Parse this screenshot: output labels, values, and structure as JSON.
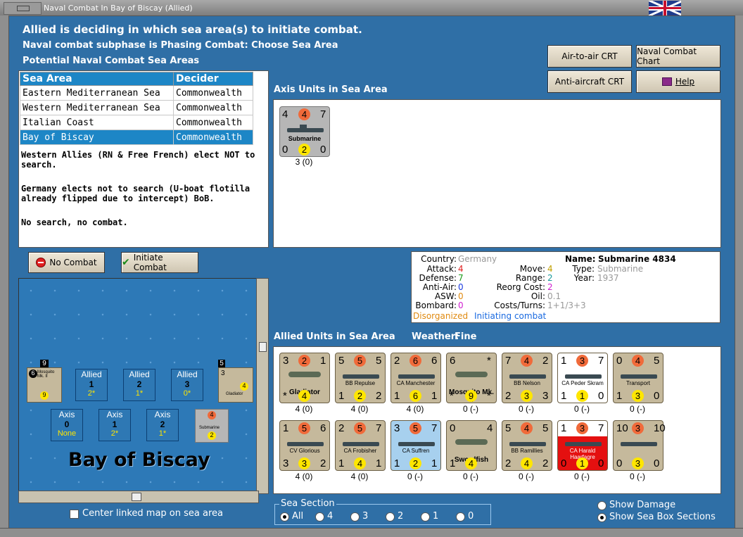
{
  "window": {
    "title": "Naval Combat In Bay of Biscay (Allied)"
  },
  "header": {
    "line1": "Allied is deciding in which sea area(s) to initiate combat.",
    "line2": "Naval combat subphase is Phasing Combat: Choose Sea Area",
    "line3": "Potential Naval Combat Sea Areas"
  },
  "buttons": {
    "air_to_air": "Air-to-air CRT",
    "naval_chart": "Naval Combat Chart",
    "anti_aircraft": "Anti-aircraft CRT",
    "help": "Help",
    "no_combat": "No Combat",
    "initiate_combat": "Initiate Combat"
  },
  "sea_table": {
    "headers": [
      "Sea Area",
      "Decider"
    ],
    "rows": [
      [
        "Eastern Mediterranean Sea",
        "Commonwealth"
      ],
      [
        "Western Mediterranean Sea",
        "Commonwealth"
      ],
      [
        "Italian Coast",
        "Commonwealth"
      ],
      [
        "Bay of Biscay",
        "Commonwealth"
      ]
    ],
    "selected_index": 3
  },
  "notes": [
    "Western Allies (RN & Free French) elect NOT to search.",
    "Germany elects not to search (U-boat flotilla already flipped due to intercept) BoB.",
    "No search, no combat."
  ],
  "axis_units": {
    "title": "Axis Units in Sea Area",
    "units": [
      {
        "name": "Submarine",
        "tl": "4",
        "tc": "4",
        "tr": "7",
        "bl": "0",
        "bc": "2",
        "br": "0",
        "caption": "3 (0)"
      }
    ]
  },
  "unit_info": {
    "country_label": "Country:",
    "country": "Germany",
    "attack_label": "Attack:",
    "attack": "4",
    "defense_label": "Defense:",
    "defense": "7",
    "antiair_label": "Anti-Air:",
    "antiair": "0",
    "asw_label": "ASW:",
    "asw": "0",
    "bombard_label": "Bombard:",
    "bombard": "0",
    "move_label": "Move:",
    "move": "4",
    "range_label": "Range:",
    "range": "2",
    "reorg_label": "Reorg Cost:",
    "reorg": "2",
    "oil_label": "Oil:",
    "oil": "0.1",
    "costs_label": "Costs/Turns:",
    "costs": "1+1/3+3",
    "name_label": "Name:",
    "name": "Submarine 4834",
    "type_label": "Type:",
    "type": "Submarine",
    "year_label": "Year:",
    "year": "1937",
    "status1": "Disorganized",
    "status2": "Initiating combat"
  },
  "allied_units": {
    "title": "Allied Units in Sea Area",
    "weather_label": "Weather:",
    "weather": "Fine",
    "row1": [
      {
        "name": "Gladiator",
        "tl": "3",
        "tc": "2",
        "tr": "1",
        "bl": "*",
        "bc": "4",
        "br": "",
        "caption": "4 (0)",
        "kind": "air"
      },
      {
        "name": "BB Repulse",
        "tl": "5",
        "tc": "5",
        "tr": "5",
        "bl": "1",
        "bc": "2",
        "br": "2",
        "caption": "4 (0)",
        "kind": "ship"
      },
      {
        "name": "CA Manchester",
        "tl": "2",
        "tc": "6",
        "tr": "6",
        "bl": "1",
        "bc": "6",
        "br": "1",
        "caption": "4 (0)",
        "kind": "ship"
      },
      {
        "name": "Mosquito Mk. II",
        "tl": "6",
        "tc": "",
        "tr": "*",
        "bl": "*",
        "bc": "9",
        "br": "*",
        "caption": "0 (-)",
        "kind": "air"
      },
      {
        "name": "BB Nelson",
        "tl": "7",
        "tc": "4",
        "tr": "2",
        "bl": "2",
        "bc": "3",
        "br": "3",
        "caption": "0 (-)",
        "kind": "ship"
      },
      {
        "name": "CA Peder Skram",
        "tl": "1",
        "tc": "3",
        "tr": "7",
        "bl": "1",
        "bc": "1",
        "br": "0",
        "caption": "0 (-)",
        "kind": "ship_white"
      },
      {
        "name": "Transport",
        "tl": "0",
        "tc": "4",
        "tr": "5",
        "bl": "1",
        "bc": "3",
        "br": "0",
        "caption": "0 (-)",
        "kind": "ship"
      }
    ],
    "row2": [
      {
        "name": "CV Glorious",
        "tl": "1",
        "tc": "5",
        "tr": "6",
        "bl": "3",
        "bc": "3",
        "br": "2",
        "caption": "4 (0)",
        "kind": "ship"
      },
      {
        "name": "CA Frobisher",
        "tl": "2",
        "tc": "5",
        "tr": "7",
        "bl": "1",
        "bc": "4",
        "br": "1",
        "caption": "4 (0)",
        "kind": "ship"
      },
      {
        "name": "CA Suffren",
        "tl": "3",
        "tc": "5",
        "tr": "7",
        "bl": "1",
        "bc": "2",
        "br": "1",
        "caption": "0 (-)",
        "kind": "ship_blue"
      },
      {
        "name": "Swordfish",
        "tl": "0",
        "tc": "",
        "tr": "4",
        "bl": "1",
        "bc": "4",
        "br": "",
        "caption": "0 (-)",
        "kind": "air"
      },
      {
        "name": "BB Ramillies",
        "tl": "5",
        "tc": "4",
        "tr": "5",
        "bl": "2",
        "bc": "4",
        "br": "2",
        "caption": "0 (-)",
        "kind": "ship"
      },
      {
        "name": "CA Harald Haarfagre",
        "tl": "1",
        "tc": "3",
        "tr": "7",
        "bl": "0",
        "bc": "1",
        "br": "0",
        "caption": "0 (-)",
        "kind": "ship_red"
      },
      {
        "name": "",
        "tl": "10",
        "tc": "3",
        "tr": "10",
        "bl": "0",
        "bc": "3",
        "br": "0",
        "caption": "0 (-)",
        "kind": "ship"
      }
    ]
  },
  "map": {
    "area_name": "Bay of Biscay",
    "allied_boxes": [
      {
        "label": "Allied",
        "num": "1",
        "sub": "2*"
      },
      {
        "label": "Allied",
        "num": "2",
        "sub": "1*"
      },
      {
        "label": "Allied",
        "num": "3",
        "sub": "0*"
      }
    ],
    "axis_boxes": [
      {
        "label": "Axis",
        "num": "0",
        "sub": "None"
      },
      {
        "label": "Axis",
        "num": "1",
        "sub": "2*"
      },
      {
        "label": "Axis",
        "num": "2",
        "sub": "1*"
      }
    ],
    "stack_top_count": "9",
    "stack_left_count": "3",
    "stack_right_count": "5",
    "mini_units": [
      {
        "name": "Mosquito Mk. II",
        "a": "6",
        "b": "9"
      },
      {
        "name": "Gladiator",
        "a": "3",
        "b": "4"
      },
      {
        "name": "Submarine",
        "a": "4",
        "b": "2"
      }
    ],
    "center_label": "Center linked map on sea area"
  },
  "sea_section": {
    "label": "Sea Section",
    "options": [
      "All",
      "4",
      "3",
      "2",
      "1",
      "0"
    ],
    "selected": "All"
  },
  "view_options": {
    "show_damage": "Show Damage",
    "show_sea_box": "Show Sea Box Sections"
  }
}
